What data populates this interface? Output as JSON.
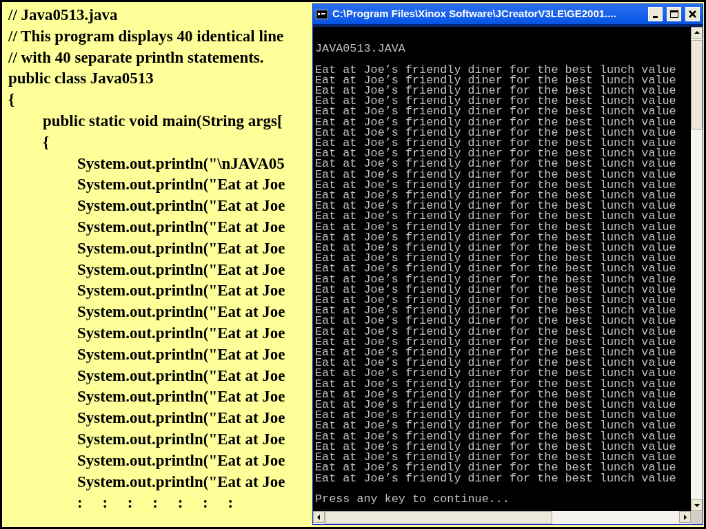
{
  "code": [
    {
      "text": "// Java0513.java"
    },
    {
      "text": "// This program displays 40 identical line"
    },
    {
      "text": "// with 40 separate println statements."
    },
    {
      "text": "public class Java0513"
    },
    {
      "text": "{",
      "children": [
        {
          "text": "public static void main(String args["
        },
        {
          "text": "{",
          "children": [
            {
              "text": "System.out.println(\"\\nJAVA05"
            },
            {
              "text": "System.out.println(\"Eat at Joe"
            },
            {
              "text": "System.out.println(\"Eat at Joe"
            },
            {
              "text": "System.out.println(\"Eat at Joe"
            },
            {
              "text": "System.out.println(\"Eat at Joe"
            },
            {
              "text": "System.out.println(\"Eat at Joe"
            },
            {
              "text": "System.out.println(\"Eat at Joe"
            },
            {
              "text": "System.out.println(\"Eat at Joe"
            },
            {
              "text": "System.out.println(\"Eat at Joe"
            },
            {
              "text": "System.out.println(\"Eat at Joe"
            },
            {
              "text": "System.out.println(\"Eat at Joe"
            },
            {
              "text": "System.out.println(\"Eat at Joe"
            },
            {
              "text": "System.out.println(\"Eat at Joe"
            },
            {
              "text": "System.out.println(\"Eat at Joe"
            },
            {
              "text": "System.out.println(\"Eat at Joe"
            },
            {
              "text": "System.out.println(\"Eat at Joe"
            },
            {
              "text": ":     :     :     :     :     :     :"
            }
          ]
        }
      ]
    }
  ],
  "window": {
    "title": "C:\\Program Files\\Xinox Software\\JCreatorV3LE\\GE2001....",
    "console": {
      "header": "JAVA0513.JAVA",
      "output_lines": [
        "Eat at Joe’s friendly diner for the best lunch value",
        "Eat at Joe’s friendly diner for the best lunch value",
        "Eat at Joe’s friendly diner for the best lunch value",
        "Eat at Joe’s friendly diner for the best lunch value",
        "Eat at Joe’s friendly diner for the best lunch value",
        "Eat at Joe’s friendly diner for the best lunch value",
        "Eat at Joe’s friendly diner for the best lunch value",
        "Eat at Joe’s friendly diner for the best lunch value",
        "Eat at Joe’s friendly diner for the best lunch value",
        "Eat at Joe’s friendly diner for the best lunch value",
        "Eat at Joe’s friendly diner for the best lunch value",
        "Eat at Joe’s friendly diner for the best lunch value",
        "Eat at Joe’s friendly diner for the best lunch value",
        "Eat at Joe’s friendly diner for the best lunch value",
        "Eat at Joe’s friendly diner for the best lunch value",
        "Eat at Joe’s friendly diner for the best lunch value",
        "Eat at Joe’s friendly diner for the best lunch value",
        "Eat at Joe’s friendly diner for the best lunch value",
        "Eat at Joe’s friendly diner for the best lunch value",
        "Eat at Joe’s friendly diner for the best lunch value",
        "Eat at Joe’s friendly diner for the best lunch value",
        "Eat at Joe’s friendly diner for the best lunch value",
        "Eat at Joe’s friendly diner for the best lunch value",
        "Eat at Joe’s friendly diner for the best lunch value",
        "Eat at Joe’s friendly diner for the best lunch value",
        "Eat at Joe’s friendly diner for the best lunch value",
        "Eat at Joe’s friendly diner for the best lunch value",
        "Eat at Joe’s friendly diner for the best lunch value",
        "Eat at Joe’s friendly diner for the best lunch value",
        "Eat at Joe’s friendly diner for the best lunch value",
        "Eat at Joe’s friendly diner for the best lunch value",
        "Eat at Joe’s friendly diner for the best lunch value",
        "Eat at Joe’s friendly diner for the best lunch value",
        "Eat at Joe’s friendly diner for the best lunch value",
        "Eat at Joe’s friendly diner for the best lunch value",
        "Eat at Joe’s friendly diner for the best lunch value",
        "Eat at Joe’s friendly diner for the best lunch value",
        "Eat at Joe’s friendly diner for the best lunch value",
        "Eat at Joe’s friendly diner for the best lunch value",
        "Eat at Joe’s friendly diner for the best lunch value"
      ],
      "prompt": "Press any key to continue..."
    }
  }
}
